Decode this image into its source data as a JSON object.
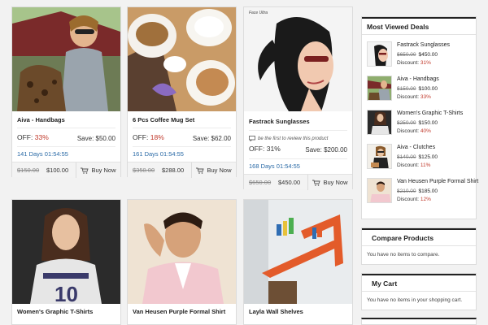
{
  "products": [
    {
      "title": "Aiva - Handbags",
      "off_label": "OFF:",
      "off": "33%",
      "save": "Save: $50.00",
      "days": "141 Days 01:54:55",
      "old_price": "$150.00",
      "new_price": "$100.00",
      "buy": "Buy Now",
      "review": ""
    },
    {
      "title": "6 Pcs Coffee Mug Set",
      "off_label": "OFF:",
      "off": "18%",
      "save": "Save: $62.00",
      "days": "161 Days 01:54:55",
      "old_price": "$350.00",
      "new_price": "$288.00",
      "buy": "Buy Now",
      "review": ""
    },
    {
      "title": "Fastrack Sunglasses",
      "off_label": "OFF:",
      "off": "31%",
      "save": "Save: $200.00",
      "days": "168 Days 01:54:55",
      "old_price": "$650.00",
      "new_price": "$450.00",
      "buy": "Buy Now",
      "review": "be the first to review this product"
    },
    {
      "title": "Women's Graphic T-Shirts"
    },
    {
      "title": "Van Heusen Purple Formal Shirt"
    },
    {
      "title": "Layla Wall Shelves"
    }
  ],
  "image_text": {
    "fastrack": "Face Ultra"
  },
  "sidebar": {
    "most_viewed": {
      "title": "Most Viewed Deals",
      "items": [
        {
          "name": "Fastrack Sunglasses",
          "old": "$650.00",
          "new": "$450.00",
          "discount_label": "Discount:",
          "discount": "31%"
        },
        {
          "name": "Aiva - Handbags",
          "old": "$150.00",
          "new": "$100.00",
          "discount_label": "Discount:",
          "discount": "33%"
        },
        {
          "name": "Women's Graphic T-Shirts",
          "old": "$250.00",
          "new": "$150.00",
          "discount_label": "Discount:",
          "discount": "40%"
        },
        {
          "name": "Aiva - Clutches",
          "old": "$140.00",
          "new": "$125.00",
          "discount_label": "Discount:",
          "discount": "11%"
        },
        {
          "name": "Van Heusen Purple Formal Shirt",
          "old": "$210.00",
          "new": "$185.00",
          "discount_label": "Discount:",
          "discount": "12%"
        }
      ]
    },
    "compare": {
      "title": "Compare Products",
      "note": "You have no items to compare."
    },
    "cart": {
      "title": "My Cart",
      "note": "You have no items in your shopping cart."
    }
  },
  "colors": {
    "accent_red": "#c0392b",
    "timer_blue": "#2a6aa6",
    "header_rule": "#222222"
  },
  "icons": [
    "cart-icon",
    "comment-icon"
  ]
}
